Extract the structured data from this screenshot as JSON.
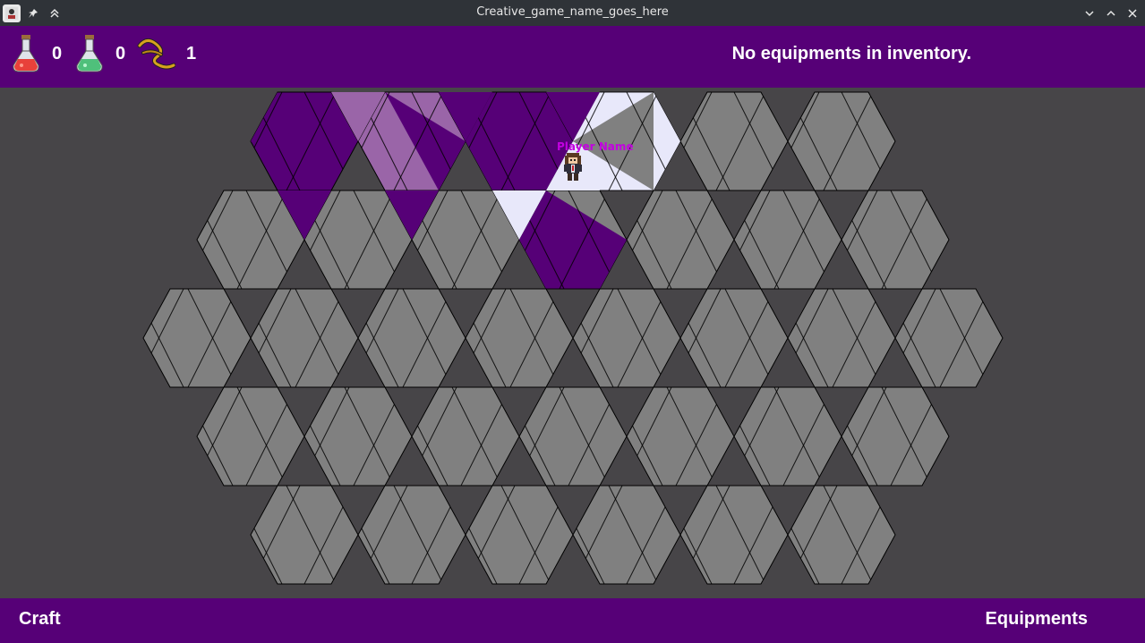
{
  "window": {
    "title": "Creative_game_name_goes_here",
    "icons": [
      "app-icon",
      "pin-icon",
      "keep-above-icon",
      "minimize-icon",
      "maximize-icon",
      "close-icon"
    ]
  },
  "resources": [
    {
      "name": "red-potion",
      "count": "0",
      "icon": "red-potion-icon"
    },
    {
      "name": "green-potion",
      "count": "0",
      "icon": "green-potion-icon"
    },
    {
      "name": "rope",
      "count": "1",
      "icon": "rope-icon"
    }
  ],
  "inventory": {
    "status": "No equipments in inventory."
  },
  "player": {
    "name": "Player Name"
  },
  "board": {
    "rows": [
      {
        "cells": [
          "visited",
          "visible",
          "visited",
          "fog",
          "fog",
          "fog"
        ]
      },
      {
        "cells": [
          "fog",
          "fog",
          "fog",
          "fog",
          "fog",
          "fog",
          "fog"
        ]
      },
      {
        "cells": [
          "fog",
          "fog",
          "fog",
          "fog",
          "fog",
          "fog",
          "fog",
          "fog"
        ]
      },
      {
        "cells": [
          "fog",
          "fog",
          "fog",
          "fog",
          "fog",
          "fog",
          "fog"
        ]
      },
      {
        "cells": [
          "fog",
          "fog",
          "fog",
          "fog",
          "fog",
          "fog"
        ]
      }
    ],
    "triangles": [
      {
        "row": 0,
        "col": 0,
        "state": "visited"
      },
      {
        "row": 0,
        "col": 1,
        "state": "visible"
      },
      {
        "row": 0,
        "col": 2,
        "state": "visited"
      },
      {
        "row": 0,
        "col": 3,
        "state": "visited"
      },
      {
        "row": 0,
        "col": 4,
        "state": "visited"
      },
      {
        "row": 0,
        "col": 5,
        "state": "visited"
      },
      {
        "row": 0,
        "col": 6,
        "state": "visited"
      },
      {
        "row": 0,
        "col": 7,
        "state": "visited"
      },
      {
        "row": 0,
        "col": 8,
        "state": "current"
      },
      {
        "row": 0,
        "col": 9,
        "state": "current"
      },
      {
        "row": 0,
        "col": 10,
        "state": "current"
      },
      {
        "row": 1,
        "col": 1,
        "state": "visited"
      },
      {
        "row": 1,
        "col": 3,
        "state": "visited"
      },
      {
        "row": 1,
        "col": 5,
        "state": "current"
      },
      {
        "row": 1,
        "col": 6,
        "state": "visited"
      },
      {
        "row": 1,
        "col": 7,
        "state": "visited"
      }
    ],
    "colors": {
      "fog": "#808080",
      "visited": "#560077",
      "visible": "#9a65a8",
      "current": "#e8e8fa",
      "edge": "#000000"
    }
  },
  "buttons": {
    "craft": "Craft",
    "equipments": "Equipments"
  }
}
